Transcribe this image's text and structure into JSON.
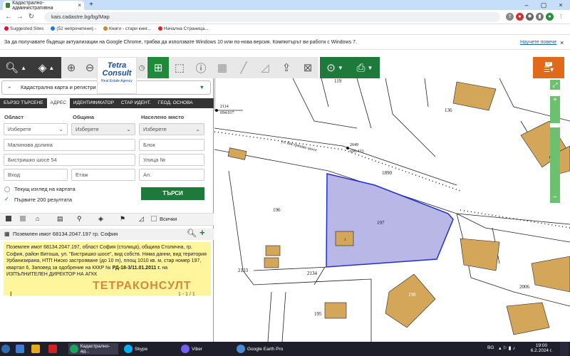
{
  "browser": {
    "tab_title": "Кадастрално-административна",
    "url": "kais.cadastre.bg/bg/Map",
    "bookmarks": [
      "Suggested Sites",
      "(52 непрочетени) -",
      "Книги - стари книг...",
      "Начална Страница..."
    ],
    "infobar_text": "За да получавате бъдещи актуализации на Google Chrome, трябва да използвате Windows 10 или по-нова версия. Компютърът ви работи с Windows 7.",
    "infobar_link": "Научете повече"
  },
  "logo": {
    "line1": "Tetra",
    "line2": "Consult",
    "line3": "Real Estate Agency"
  },
  "cart_count": "0",
  "panel": {
    "layer_select": "Кадастрална карта и регистри",
    "tabs": [
      "БЪРЗО ТЪРСЕНЕ",
      "АДРЕС",
      "ИДЕНТИФИКАТОР",
      "СТАР ИДЕНТ.",
      "ГЕОД. ОСНОВА"
    ],
    "labels": {
      "region": "Област",
      "municipality": "Община",
      "settlement": "Населено място"
    },
    "region_value": "Изберете",
    "municipality_value": "Изберете",
    "settlement_value": "Изберете",
    "field_district": "Малинова долина",
    "field_block": "Блок",
    "field_street": "Бистришко шосе 54",
    "field_street_no": "Улица №",
    "field_entrance": "Вход",
    "field_floor": "Етаж",
    "field_apt": "Ап.",
    "current_view_label": "Текущ изглед на картата",
    "first200_label": "Първите 200 резултата",
    "search_button": "ТЪРСИ",
    "all_label": "Всички",
    "result_header": "Поземлен имот 68134.2047.197 гр. София",
    "result_text": "Поземлен имот 68134.2047.197, област София (столица), община Столична, гр. София, район Витоша, ул. \"Бистришко шосе\", вид собств. Няма данни, вид територия Урбанизирана, НТП Ниско застрояване (до 10 m), площ 1010 кв. м, стар номер 197, квартал 6,",
    "result_text2": "Заповед за одобрение на КККР №",
    "result_bold": "РД-18-3/11.01.2011 г.",
    "result_text3": "на ИЗПЪЛНИТЕЛЕН ДИРЕКТОР НА АГКК",
    "pager": "1 - 1 / 1",
    "watermark": "ТЕТРАКОНСУЛТ"
  },
  "map": {
    "labels": [
      "119",
      "136",
      "2114",
      "694.017",
      "ул. Бистришко шосе",
      "2049",
      "696.433",
      "1890",
      "196",
      "197",
      "2133",
      "2134",
      "195",
      "198",
      "2006",
      "1"
    ]
  },
  "taskbar": {
    "apps": [
      "Кадастрално-ад...",
      "Skype",
      "Viber",
      "Google Earth Pro"
    ],
    "lang": "BG",
    "time": "19:00",
    "date": "6.2.2024 г."
  }
}
